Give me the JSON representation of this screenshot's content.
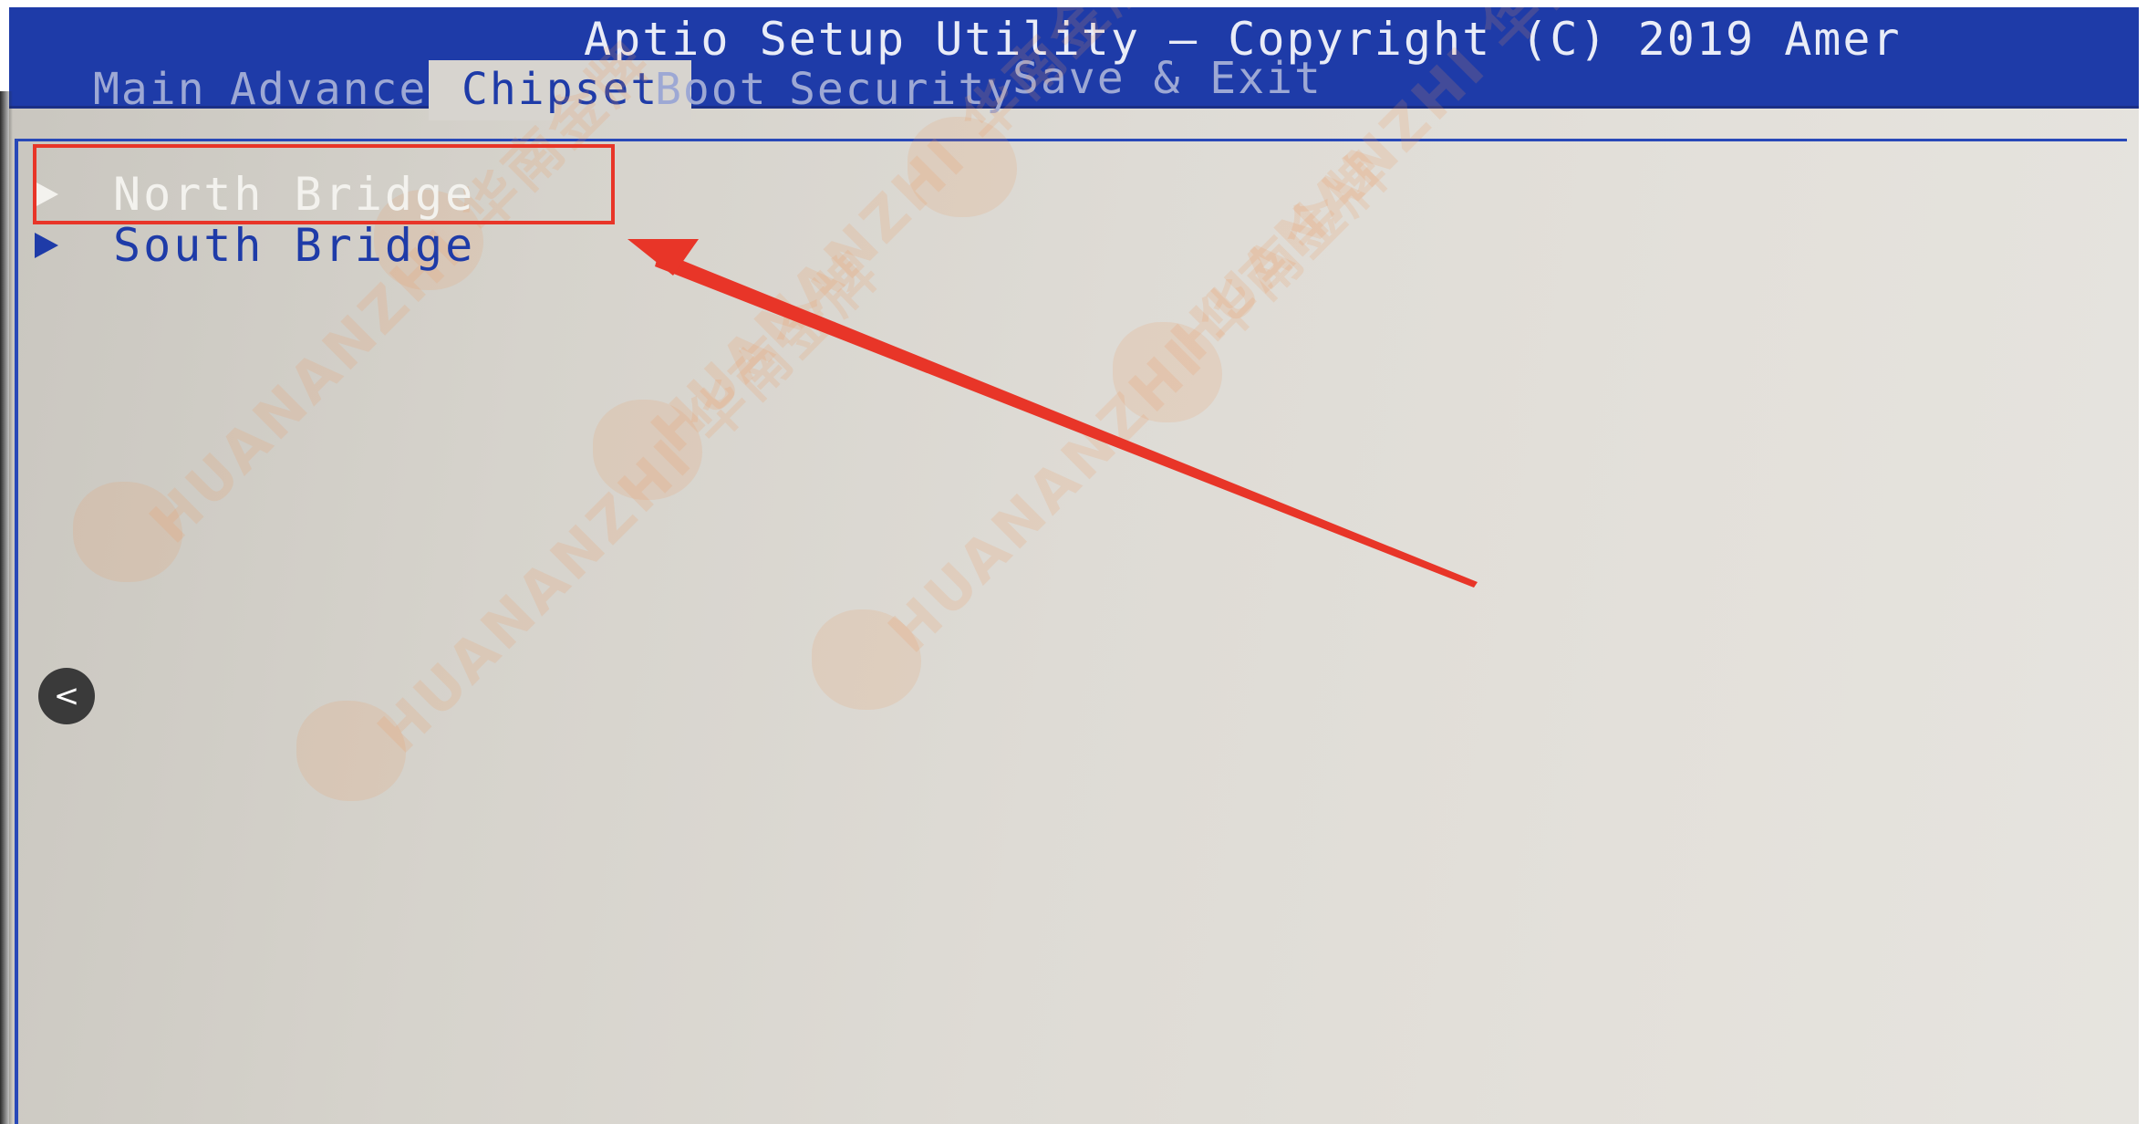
{
  "window": {
    "title": "Aptio Setup Utility – Copyright (C) 2019 Amer"
  },
  "tabs": [
    {
      "label": "Main",
      "active": false
    },
    {
      "label": "Advanced",
      "active": false
    },
    {
      "label": "Chipset",
      "active": true
    },
    {
      "label": "Boot",
      "active": false
    },
    {
      "label": "Security",
      "active": false
    },
    {
      "label": "Save & Exit",
      "active": false
    }
  ],
  "menu": {
    "items": [
      {
        "label": "North Bridge",
        "selected": true
      },
      {
        "label": "South Bridge",
        "selected": false
      }
    ]
  },
  "watermark": {
    "brand_latin": "HUANANZHI",
    "brand_cjk": "华南金牌"
  },
  "colors": {
    "header_blue": "#1e3ba8",
    "annotation_red": "#e83528",
    "selected_text": "#f3f2ee",
    "unselected_text": "#1e3ba8"
  },
  "icons": {
    "menu_arrow": "triangle-right",
    "carousel_prev": "chevron-left"
  },
  "controls": {
    "prev_glyph": "<"
  }
}
